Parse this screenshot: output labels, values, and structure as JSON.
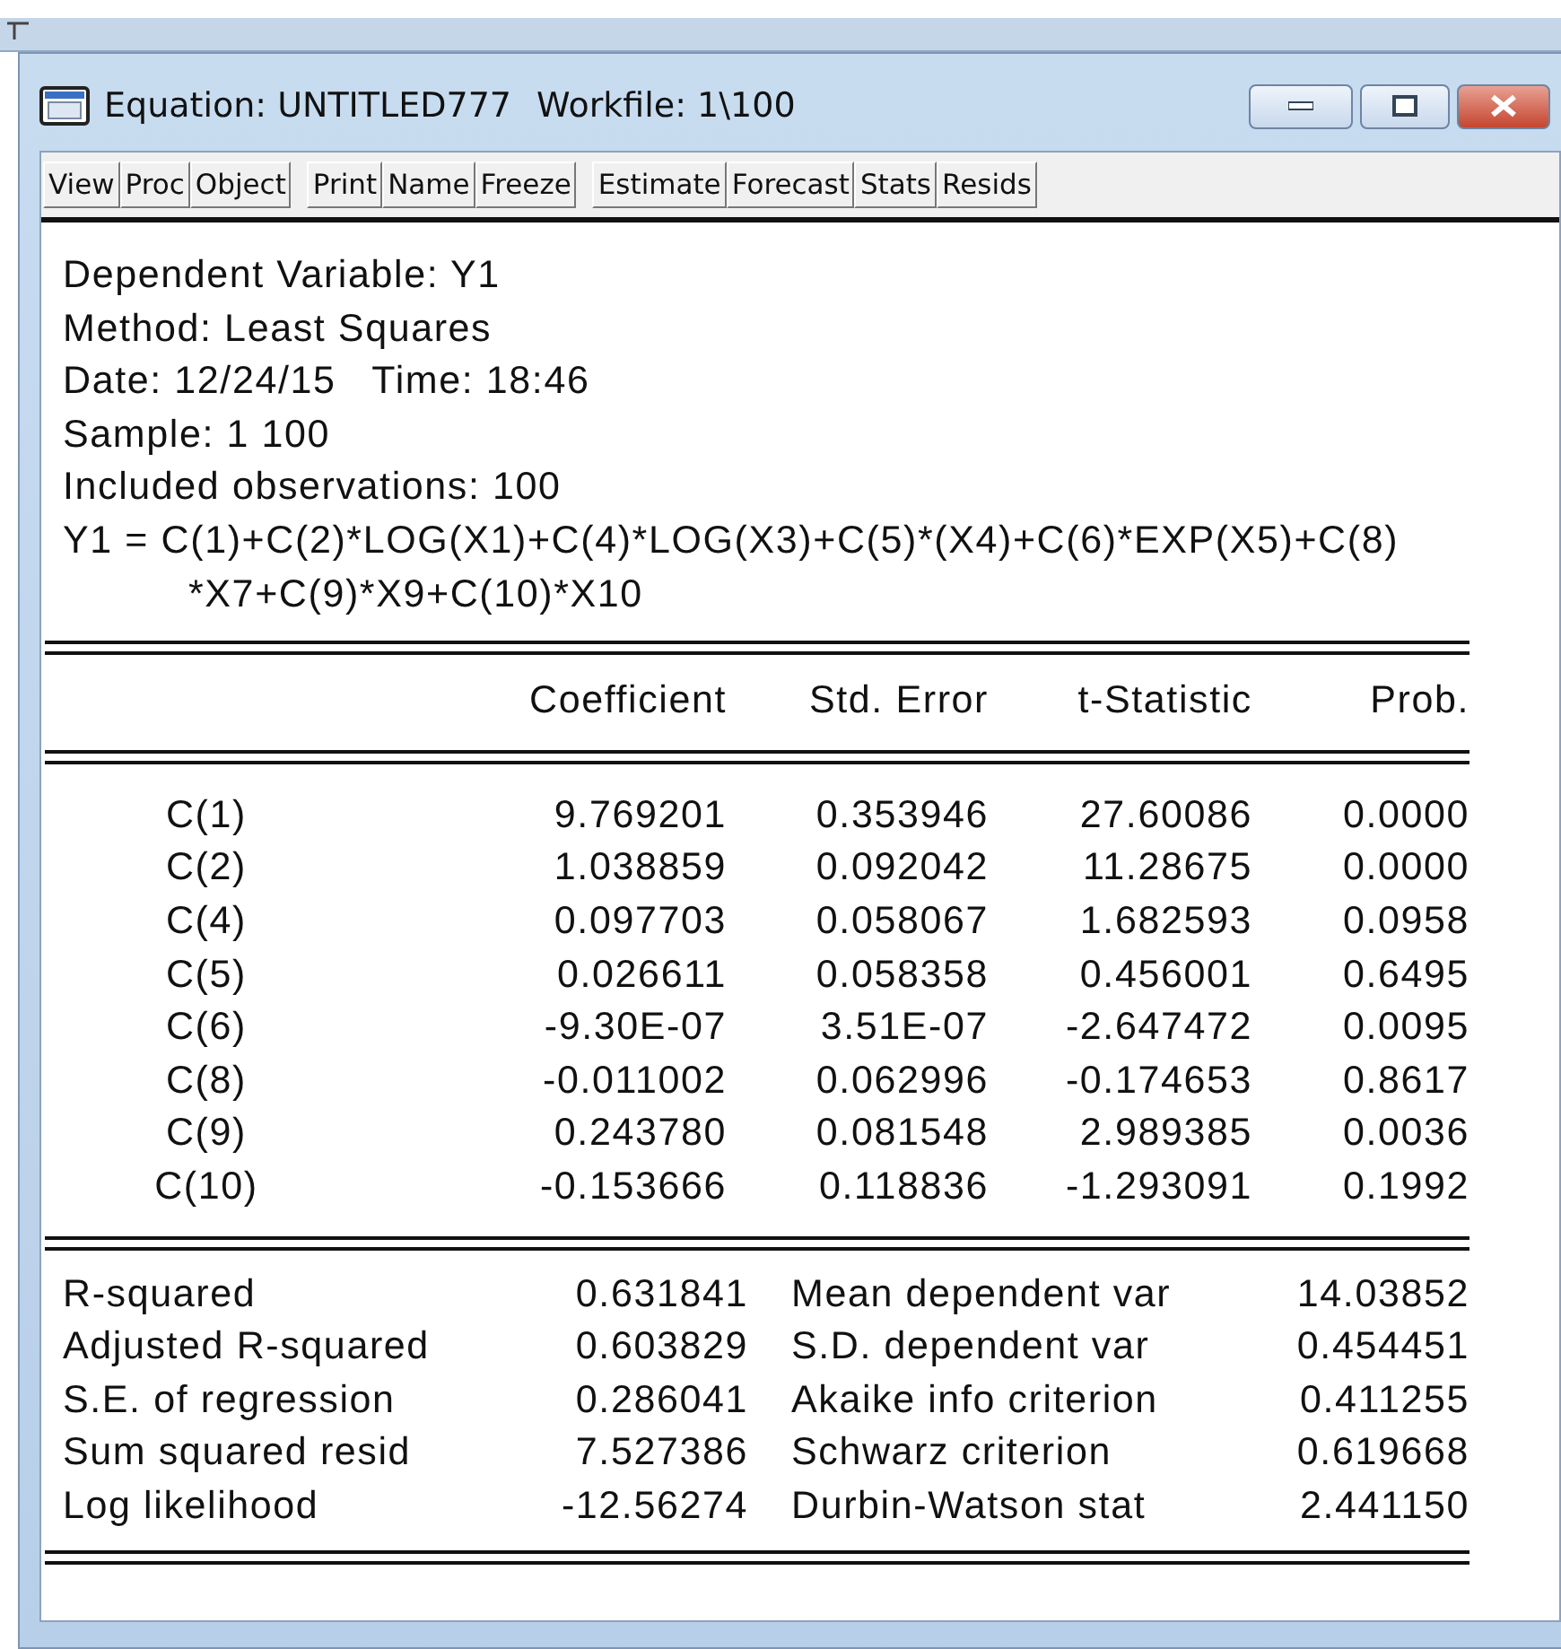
{
  "window": {
    "title": "Equation: UNTITLED777",
    "workfile": "Workfile: 1\\100"
  },
  "toolbar": [
    [
      "View",
      "Proc",
      "Object"
    ],
    [
      "Print",
      "Name",
      "Freeze"
    ],
    [
      "Estimate",
      "Forecast",
      "Stats",
      "Resids"
    ]
  ],
  "header": [
    "Dependent Variable: Y1",
    "Method: Least Squares",
    "Date: 12/24/15   Time: 18:46",
    "Sample: 1 100",
    "Included observations: 100"
  ],
  "equation": [
    "Y1 = C(1)+C(2)*LOG(X1)+C(4)*LOG(X3)+C(5)*(X4)+C(6)*EXP(X5)+C(8)",
    "*X7+C(9)*X9+C(10)*X10"
  ],
  "coefficients": {
    "columns": [
      "",
      "Coefficient",
      "Std. Error",
      "t-Statistic",
      "Prob."
    ],
    "rows": [
      [
        "C(1)",
        "9.769201",
        "0.353946",
        "27.60086",
        "0.0000"
      ],
      [
        "C(2)",
        "1.038859",
        "0.092042",
        "11.28675",
        "0.0000"
      ],
      [
        "C(4)",
        "0.097703",
        "0.058067",
        "1.682593",
        "0.0958"
      ],
      [
        "C(5)",
        "0.026611",
        "0.058358",
        "0.456001",
        "0.6495"
      ],
      [
        "C(6)",
        "-9.30E-07",
        "3.51E-07",
        "-2.647472",
        "0.0095"
      ],
      [
        "C(8)",
        "-0.011002",
        "0.062996",
        "-0.174653",
        "0.8617"
      ],
      [
        "C(9)",
        "0.243780",
        "0.081548",
        "2.989385",
        "0.0036"
      ],
      [
        "C(10)",
        "-0.153666",
        "0.118836",
        "-1.293091",
        "0.1992"
      ]
    ]
  },
  "statistics": [
    [
      "R-squared",
      "0.631841",
      "Mean dependent var",
      "14.03852"
    ],
    [
      "Adjusted R-squared",
      "0.603829",
      "S.D. dependent var",
      "0.454451"
    ],
    [
      "S.E. of regression",
      "0.286041",
      "Akaike info criterion",
      "0.411255"
    ],
    [
      "Sum squared resid",
      "7.527386",
      "Schwarz criterion",
      "0.619668"
    ],
    [
      "Log likelihood",
      "-12.56274",
      "Durbin-Watson stat",
      "2.441150"
    ]
  ]
}
